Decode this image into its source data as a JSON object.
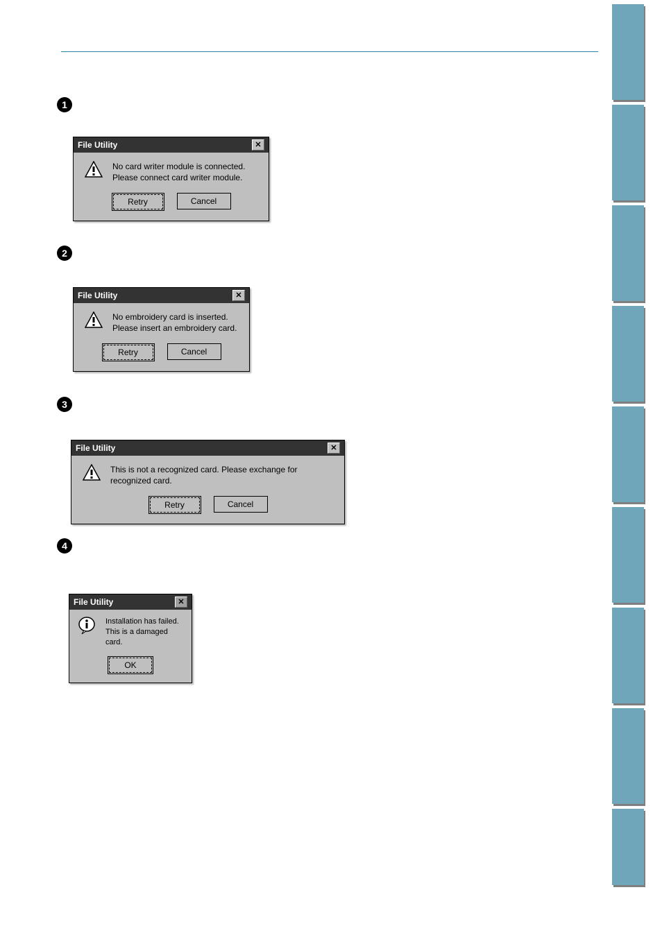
{
  "bullets": {
    "b1": "1",
    "b2": "2",
    "b3": "3",
    "b4": "4"
  },
  "dialog1": {
    "title": "File Utility",
    "message": "No card writer module is connected.\nPlease connect card writer module.",
    "retry": "Retry",
    "cancel": "Cancel"
  },
  "dialog2": {
    "title": "File Utility",
    "message": "No embroidery card is inserted.\nPlease insert an embroidery card.",
    "retry": "Retry",
    "cancel": "Cancel"
  },
  "dialog3": {
    "title": "File Utility",
    "message": "This is not a recognized card. Please exchange for recognized card.",
    "retry": "Retry",
    "cancel": "Cancel"
  },
  "dialog4": {
    "title": "File Utility",
    "message": "Installation has failed.\nThis is a damaged card.",
    "ok": "OK"
  },
  "icons": {
    "close": "✕"
  }
}
